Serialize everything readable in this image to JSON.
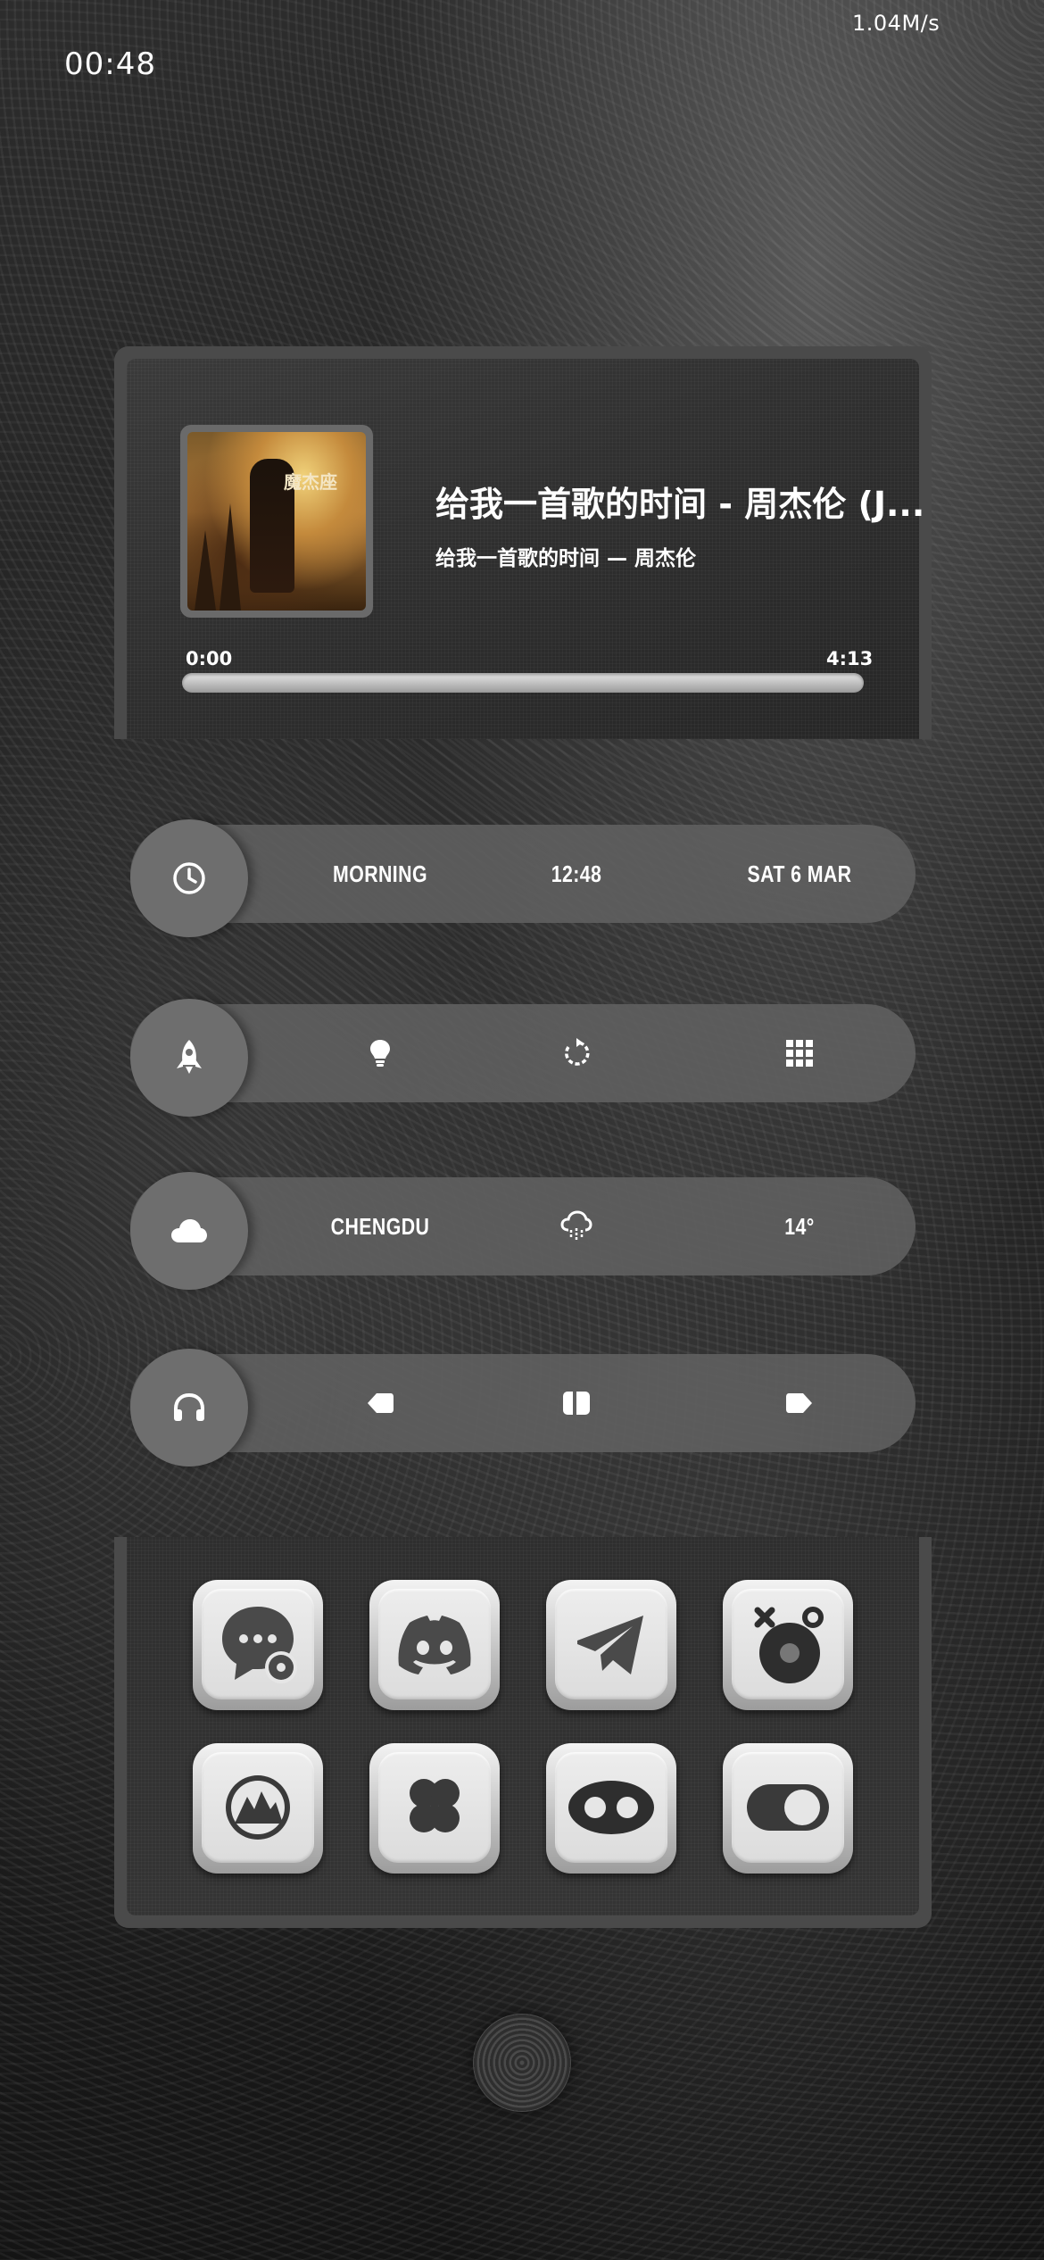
{
  "status_bar": {
    "network_speed": "1.04M/s",
    "time": "00:48"
  },
  "music": {
    "title": "给我一首歌的时间 - 周杰伦 (J...",
    "subtitle": "给我一首歌的时间 — 周杰伦",
    "album_text": "魔杰座",
    "time_current": "0:00",
    "time_total": "4:13",
    "progress": 0
  },
  "time_row": {
    "icon": "clock-icon",
    "greeting": "MORNING",
    "time": "12:48",
    "date": "SAT 6 MAR"
  },
  "tools_row": {
    "icon": "rocket-icon",
    "items": [
      "lightbulb-icon",
      "rotate-icon",
      "grid-icon"
    ]
  },
  "weather_row": {
    "icon": "cloud-icon",
    "city": "CHENGDU",
    "condition_icon": "rain-cloud-icon",
    "temperature": "14°"
  },
  "media_row": {
    "icon": "headphones-icon",
    "items": [
      "previous-icon",
      "play-pause-icon",
      "next-icon"
    ]
  },
  "apps": [
    {
      "icon": "messages-app-icon"
    },
    {
      "icon": "discord-app-icon"
    },
    {
      "icon": "telegram-app-icon"
    },
    {
      "icon": "music-app-icon"
    },
    {
      "icon": "mountain-app-icon"
    },
    {
      "icon": "clover-app-icon"
    },
    {
      "icon": "infinity-app-icon"
    },
    {
      "icon": "toggle-app-icon"
    }
  ]
}
